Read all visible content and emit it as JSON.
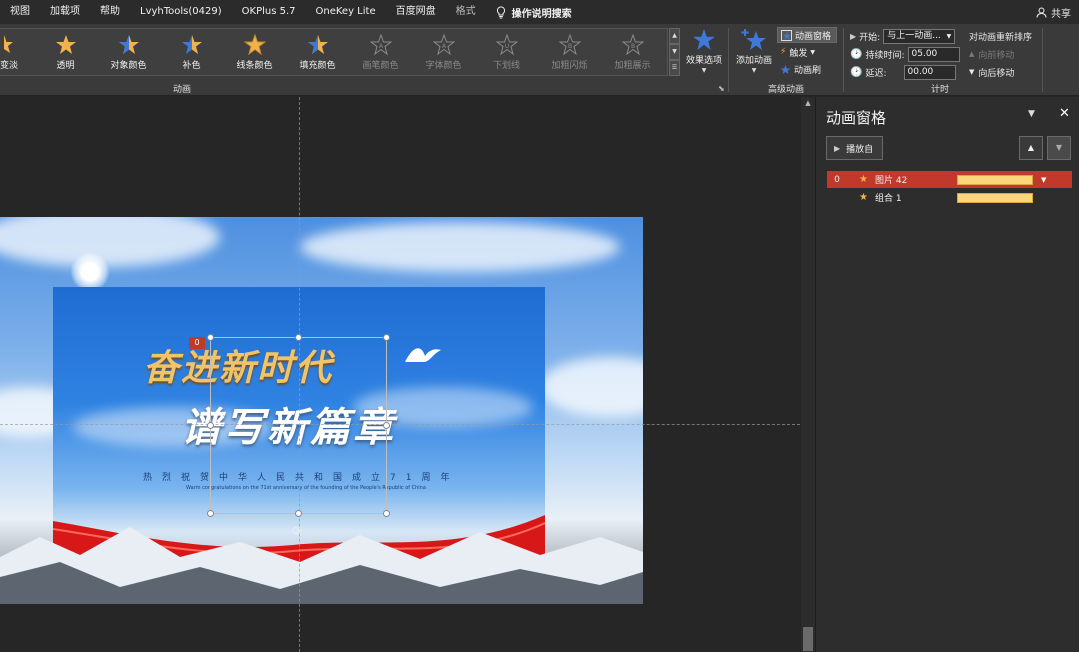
{
  "menubar": {
    "items": [
      "视图",
      "加载项",
      "帮助",
      "LvyhTools(0429)",
      "OKPlus 5.7",
      "OneKey Lite",
      "百度网盘"
    ],
    "format_tab": "格式",
    "tell_me": "操作说明搜索",
    "share": "共享"
  },
  "ribbon": {
    "animation_gallery": [
      {
        "label": "变淡",
        "disabled": false
      },
      {
        "label": "透明",
        "disabled": false
      },
      {
        "label": "对象颜色",
        "disabled": false
      },
      {
        "label": "补色",
        "disabled": false
      },
      {
        "label": "线条颜色",
        "disabled": false
      },
      {
        "label": "填充颜色",
        "disabled": false
      },
      {
        "label": "画笔颜色",
        "disabled": true
      },
      {
        "label": "字体颜色",
        "disabled": true
      },
      {
        "label": "下划线",
        "disabled": true
      },
      {
        "label": "加粗闪烁",
        "disabled": true
      },
      {
        "label": "加粗展示",
        "disabled": true
      }
    ],
    "effect_options": "效果选项",
    "animation_group": "动画",
    "add_animation": "添加动画",
    "animation_pane_btn": "动画窗格",
    "trigger": "触发",
    "animation_painter": "动画刷",
    "advanced_group": "高级动画",
    "start_label": "开始:",
    "start_value": "与上一动画...",
    "duration_label": "持续时间:",
    "duration_value": "05.00",
    "delay_label": "延迟:",
    "delay_value": "00.00",
    "timing_group": "计时",
    "reorder_title": "对动画重新排序",
    "move_earlier": "向前移动",
    "move_later": "向后移动"
  },
  "slide": {
    "title_line1": "奋进新时代",
    "title_line2": "谱写新篇章",
    "subtitle": "热烈祝贺中华人民共和国成立71周年",
    "subtitle_en": "Warm congratulations on the 71st anniversary of the founding of the People's Republic of China",
    "anim_tag": "0"
  },
  "pane": {
    "title": "动画窗格",
    "play_from": "播放自",
    "rows": [
      {
        "num": "0",
        "name": "图片 42",
        "selected": true
      },
      {
        "num": "",
        "name": "组合 1",
        "selected": false
      }
    ]
  },
  "colors": {
    "selected_row": "#c0392b",
    "timeline_bar": "#fcd77a",
    "star": "#f1b24a"
  }
}
